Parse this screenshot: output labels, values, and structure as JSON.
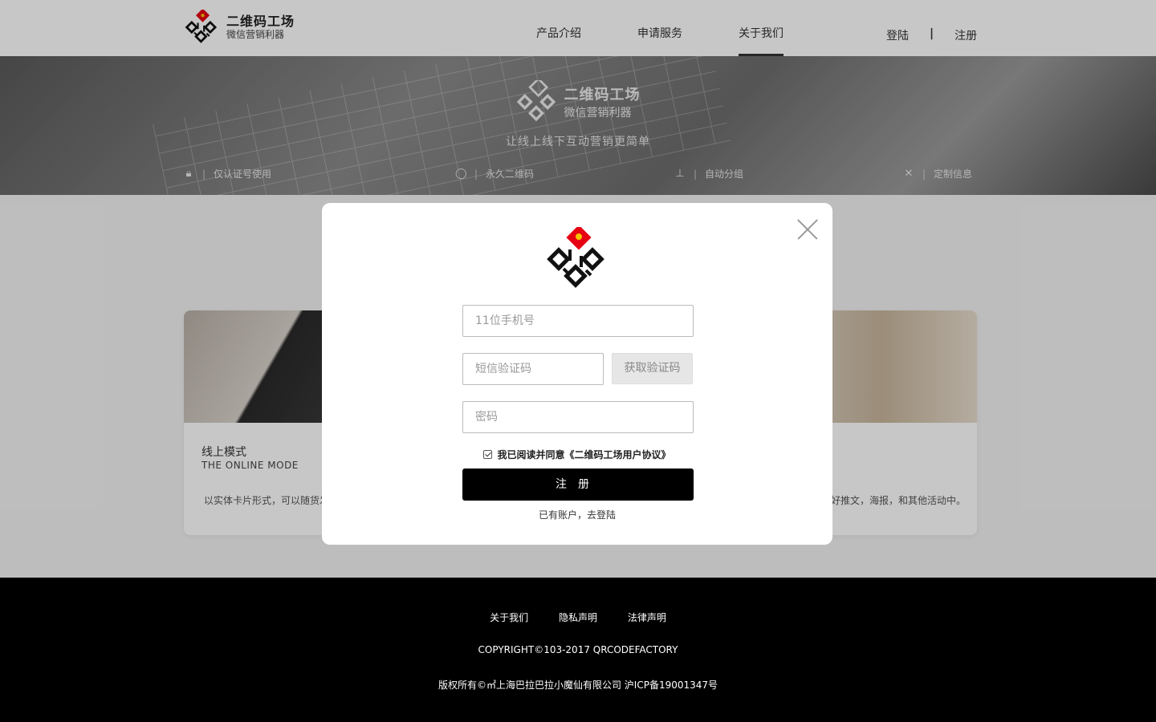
{
  "brand": {
    "title": "二维码工场",
    "subtitle": "微信营销利器"
  },
  "nav": [
    {
      "label": "产品介绍",
      "active": false
    },
    {
      "label": "申请服务",
      "active": false
    },
    {
      "label": "关于我们",
      "active": true
    }
  ],
  "auth": {
    "login": "登陆",
    "separator": "|",
    "register": "注册"
  },
  "banner": {
    "title": "二维码工场",
    "subtitle": "微信营销利器",
    "slogan": "让线上线下互动营销更简单",
    "features": [
      {
        "icon": "lock-icon",
        "label": "仅认证号使用"
      },
      {
        "icon": "circle-icon",
        "label": "永久二维码"
      },
      {
        "icon": "hierarchy-icon",
        "label": "自动分组"
      },
      {
        "icon": "tools-icon",
        "label": "定制信息"
      }
    ]
  },
  "cards": {
    "left": {
      "title": "线上模式",
      "en": "THE ONLINE MODE",
      "desc": "以实体卡片形式，可以随货发"
    },
    "right": {
      "desc": "好推文，海报，和其他活动中。"
    }
  },
  "modal": {
    "phone_placeholder": "11位手机号",
    "sms_placeholder": "短信验证码",
    "get_code": "获取验证码",
    "password_placeholder": "密码",
    "agree_text": "我已阅读并同意《二维码工场用户协议》",
    "submit": "注册",
    "login_link": "已有账户，去登陆"
  },
  "footer": {
    "links": [
      "关于我们",
      "隐私声明",
      "法律声明"
    ],
    "copyright": "COPYRIGHT©103-2017 QRCODEFACTORY",
    "icp": "版权所有©㎡上海巴拉巴拉小魔仙有限公司 沪ICP备19001347号"
  },
  "colors": {
    "accent": "#e60012",
    "button": "#000000",
    "footer_bg": "#000000"
  }
}
